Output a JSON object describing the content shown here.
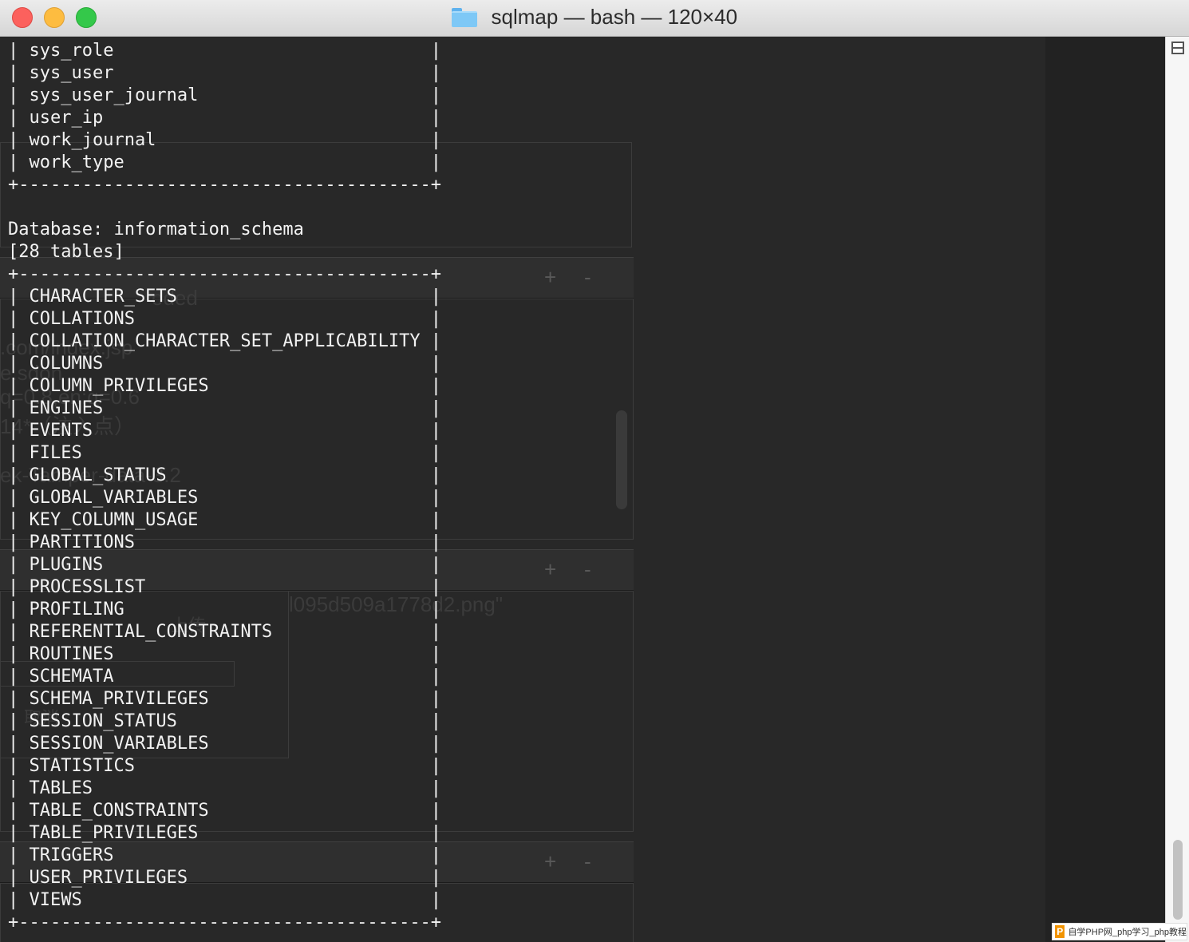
{
  "window": {
    "title": "sqlmap — bash — 120×40",
    "controls": [
      "close",
      "minimize",
      "zoom"
    ],
    "folder_icon": "folder-icon"
  },
  "terminal": {
    "lines": [
      "| sys_role                              |",
      "| sys_user                              |",
      "| sys_user_journal                      |",
      "| user_ip                               |",
      "| work_journal                          |",
      "| work_type                             |",
      "+---------------------------------------+",
      "",
      "Database: information_schema",
      "[28 tables]",
      "+---------------------------------------+",
      "| CHARACTER_SETS                        |",
      "| COLLATIONS                            |",
      "| COLLATION_CHARACTER_SET_APPLICABILITY |",
      "| COLUMNS                               |",
      "| COLUMN_PRIVILEGES                     |",
      "| ENGINES                               |",
      "| EVENTS                                |",
      "| FILES                                 |",
      "| GLOBAL_STATUS                         |",
      "| GLOBAL_VARIABLES                      |",
      "| KEY_COLUMN_USAGE                      |",
      "| PARTITIONS                            |",
      "| PLUGINS                               |",
      "| PROCESSLIST                           |",
      "| PROFILING                             |",
      "| REFERENTIAL_CONSTRAINTS               |",
      "| ROUTINES                              |",
      "| SCHEMATA                              |",
      "| SCHEMA_PRIVILEGES                     |",
      "| SESSION_STATUS                        |",
      "| SESSION_VARIABLES                     |",
      "| STATISTICS                            |",
      "| TABLES                                |",
      "| TABLE_CONSTRAINTS                     |",
      "| TABLE_PRIVILEGES                      |",
      "| TRIGGERS                              |",
      "| USER_PRIVILEGES                       |",
      "| VIEWS                                 |",
      "+---------------------------------------+"
    ]
  },
  "ghost": {
    "texts": [
      ".com/index.jsp",
      "e.sdon",
      "q=0.8,en;q=0.6",
      "14*（注入点）",
      "ek-Tamper-data-3.2",
      "l095d509a1778d2.png\"",
      "上传",
      "取消",
      "oded"
    ],
    "plus": "+",
    "minus": "-"
  },
  "watermark": {
    "logo": "P",
    "text": "自学PHP网_php学习_php教程"
  }
}
